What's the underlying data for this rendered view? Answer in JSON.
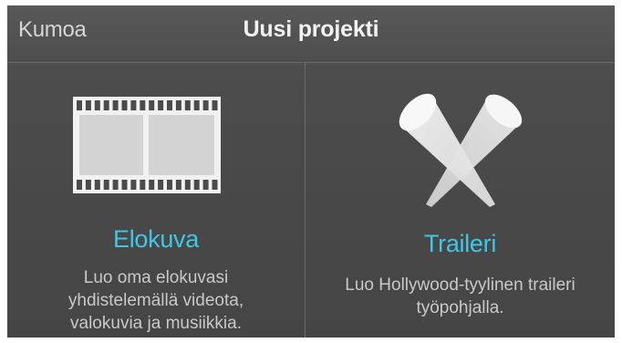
{
  "header": {
    "cancel_label": "Kumoa",
    "title": "Uusi projekti"
  },
  "options": [
    {
      "icon": "film-strip-icon",
      "label": "Elokuva",
      "description_lines": [
        "Luo oma elokuvasi",
        "yhdistelemällä videota,",
        "valokuvia ja musiikkia."
      ]
    },
    {
      "icon": "crossed-spotlights-icon",
      "label": "Traileri",
      "description_lines": [
        "Luo Hollywood-tyylinen traileri",
        "työpohjalla."
      ]
    }
  ],
  "colors": {
    "accent": "#3fc7e6",
    "background": "#4a4a4a",
    "title_text": "#f2f2f2",
    "secondary_text": "#c9c9c9"
  }
}
